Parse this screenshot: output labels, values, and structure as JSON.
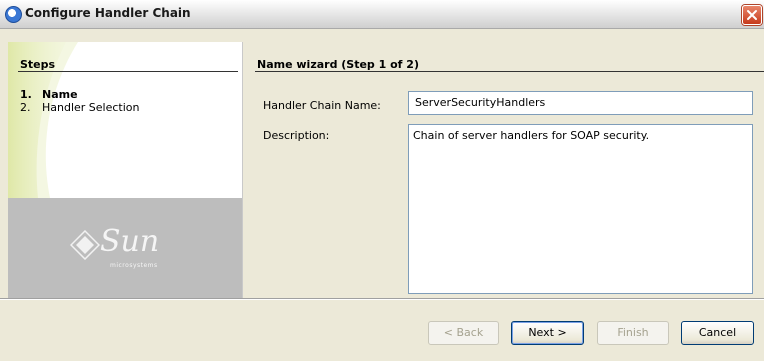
{
  "window": {
    "title": "Configure Handler Chain",
    "close_icon": "close-icon"
  },
  "steps": {
    "heading": "Steps",
    "items": [
      {
        "number": "1.",
        "label": "Name",
        "current": true
      },
      {
        "number": "2.",
        "label": "Handler Selection",
        "current": false
      }
    ]
  },
  "branding": {
    "logo_text": "Sun",
    "logo_sub": "microsystems"
  },
  "wizard": {
    "title": "Name wizard (Step 1 of 2)",
    "fields": {
      "name_label": "Handler Chain Name:",
      "name_value": "ServerSecurityHandlers",
      "description_label": "Description:",
      "description_value": "Chain of server handlers for SOAP security."
    }
  },
  "buttons": {
    "back": "< Back",
    "next": "Next >",
    "finish": "Finish",
    "cancel": "Cancel"
  },
  "colors": {
    "accent": "#003c74",
    "panel_bg": "#ece9d8",
    "logo_bg": "#bdbdbd"
  }
}
